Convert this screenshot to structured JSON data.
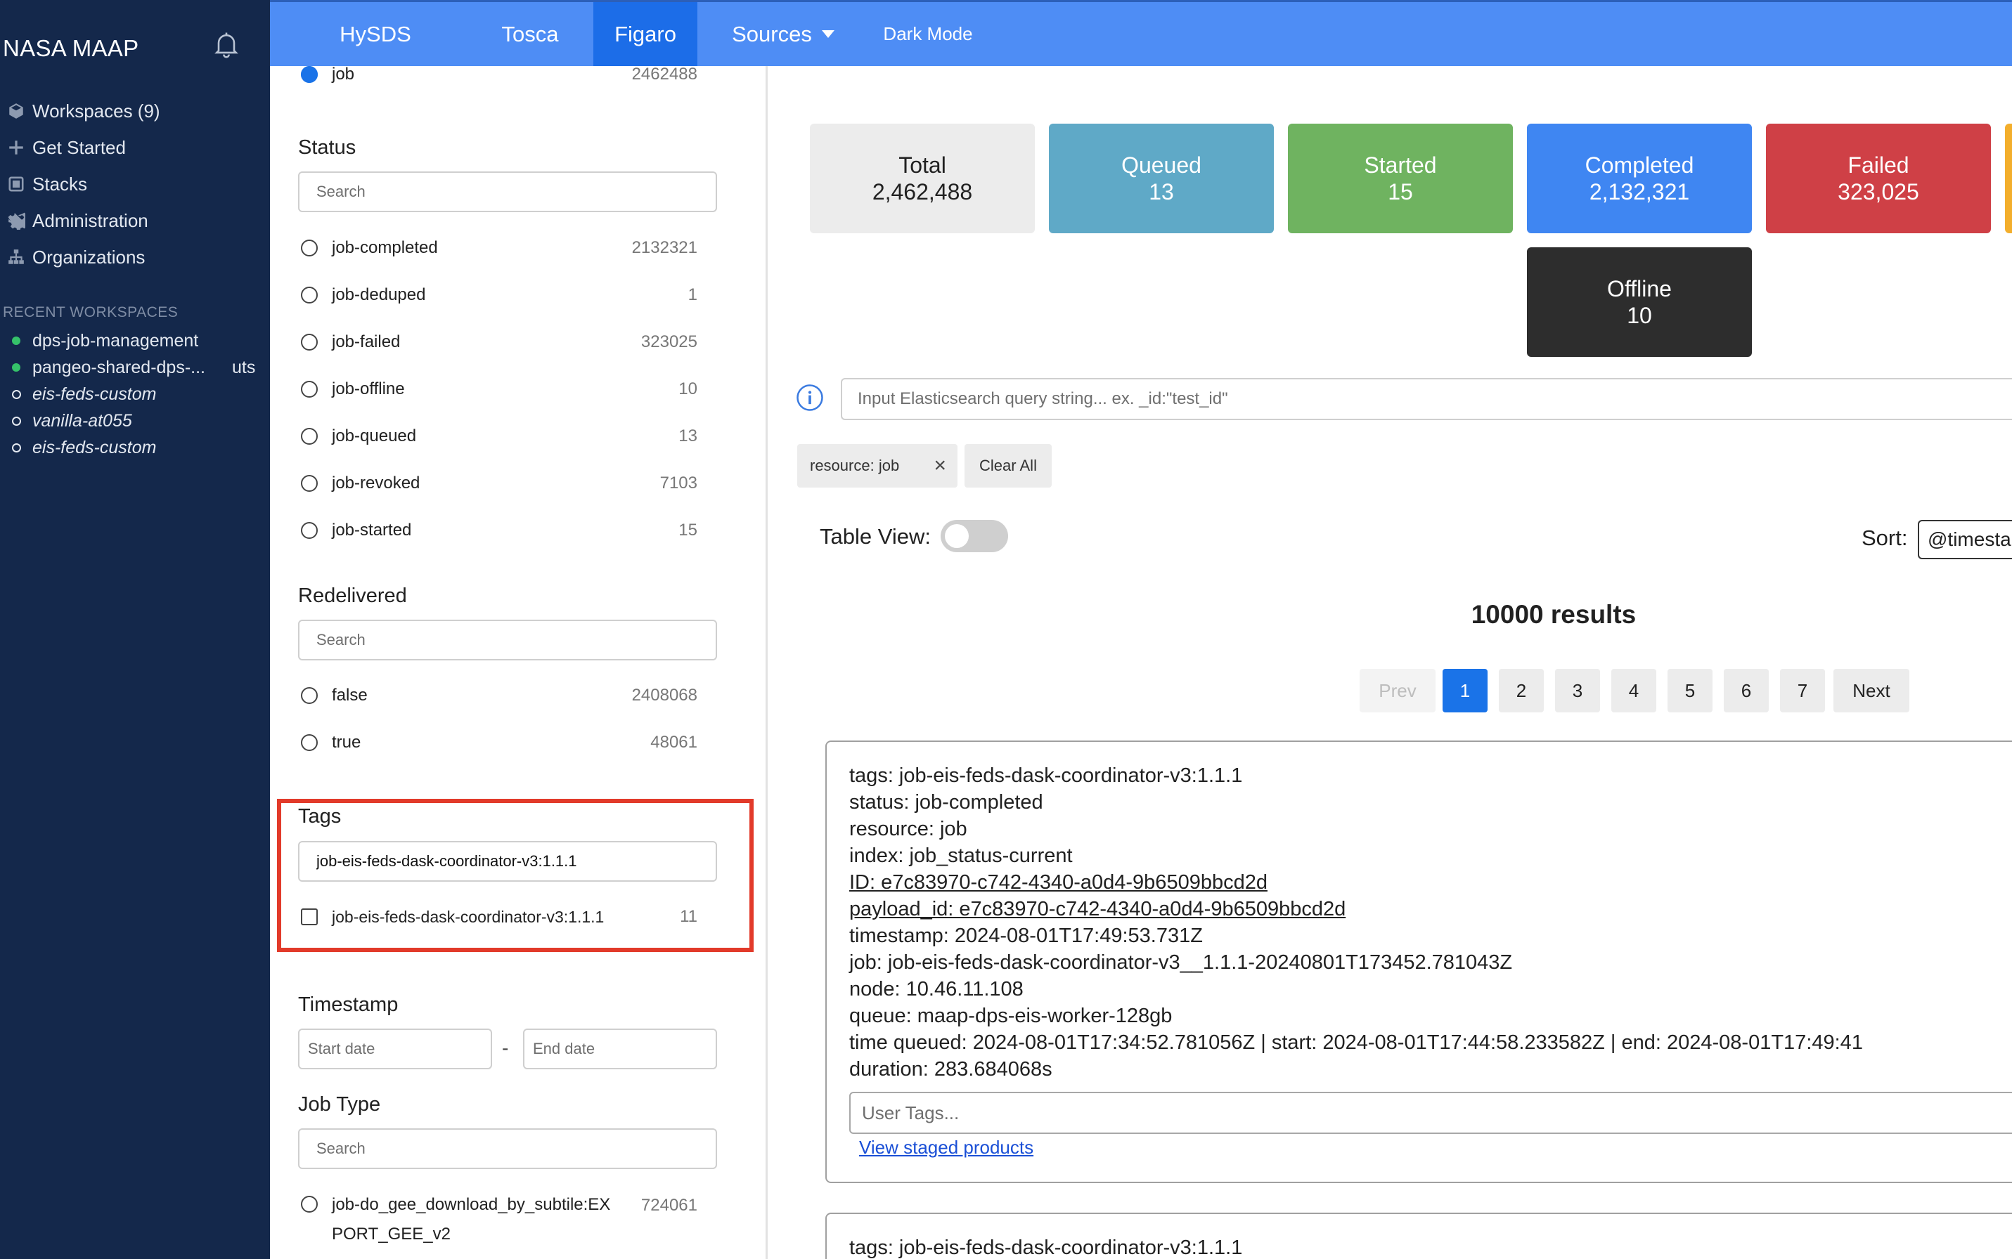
{
  "sidebar": {
    "brand": "NASA MAAP",
    "nav": [
      {
        "label": "Workspaces (9)",
        "icon": "cube-icon"
      },
      {
        "label": "Get Started",
        "icon": "plus-icon"
      },
      {
        "label": "Stacks",
        "icon": "stack-icon"
      },
      {
        "label": "Administration",
        "icon": "gear-icon"
      },
      {
        "label": "Organizations",
        "icon": "org-icon"
      }
    ],
    "recent_title": "RECENT WORKSPACES",
    "recent": [
      {
        "label": "dps-job-management",
        "status": "running"
      },
      {
        "label": "pangeo-shared-dps-...",
        "suffix": "uts",
        "status": "running"
      },
      {
        "label": "eis-feds-custom",
        "status": "stopped"
      },
      {
        "label": "vanilla-at055",
        "status": "stopped"
      },
      {
        "label": "eis-feds-custom",
        "status": "stopped"
      }
    ]
  },
  "topnav": {
    "tabs": [
      "HySDS",
      "Tosca",
      "Figaro",
      "Sources",
      "Dark Mode"
    ],
    "active_tab": "Figaro",
    "colors": {
      "bar": "#4e8df5",
      "active": "#1c6de8"
    }
  },
  "filters": {
    "resource_option": {
      "label": "job",
      "count": "2462488"
    },
    "status": {
      "heading": "Status",
      "search_placeholder": "Search",
      "options": [
        {
          "label": "job-completed",
          "count": "2132321"
        },
        {
          "label": "job-deduped",
          "count": "1"
        },
        {
          "label": "job-failed",
          "count": "323025"
        },
        {
          "label": "job-offline",
          "count": "10"
        },
        {
          "label": "job-queued",
          "count": "13"
        },
        {
          "label": "job-revoked",
          "count": "7103"
        },
        {
          "label": "job-started",
          "count": "15"
        }
      ]
    },
    "redelivered": {
      "heading": "Redelivered",
      "search_placeholder": "Search",
      "options": [
        {
          "label": "false",
          "count": "2408068"
        },
        {
          "label": "true",
          "count": "48061"
        }
      ]
    },
    "tags": {
      "heading": "Tags",
      "search_value": "job-eis-feds-dask-coordinator-v3:1.1.1",
      "options": [
        {
          "label": "job-eis-feds-dask-coordinator-v3:1.1.1",
          "count": "11"
        }
      ]
    },
    "timestamp": {
      "heading": "Timestamp",
      "start_placeholder": "Start date",
      "separator": "-",
      "end_placeholder": "End date"
    },
    "job_type": {
      "heading": "Job Type",
      "search_placeholder": "Search",
      "options": [
        {
          "label_line1": "job-do_gee_download_by_subtile:EX",
          "label_line2": "PORT_GEE_v2",
          "count": "724061"
        }
      ]
    }
  },
  "summary_cards": [
    {
      "label": "Total",
      "value": "2,462,488",
      "color": "#ececec"
    },
    {
      "label": "Queued",
      "value": "13",
      "color": "#5fa9c7"
    },
    {
      "label": "Started",
      "value": "15",
      "color": "#6fb360"
    },
    {
      "label": "Completed",
      "value": "2,132,321",
      "color": "#3f86f2"
    },
    {
      "label": "Failed",
      "value": "323,025",
      "color": "#cf4046"
    },
    {
      "label": "Offline",
      "value": "10",
      "color": "#2d2d2d"
    }
  ],
  "query": {
    "placeholder": "Input Elasticsearch query string... ex. _id:\"test_id\""
  },
  "active_filters": {
    "chip": "resource: job",
    "chip_remove": "×",
    "clear_all": "Clear All"
  },
  "view": {
    "table_view_label": "Table View:",
    "table_view_on": false,
    "sort_label": "Sort:",
    "sort_value": "@timestamp"
  },
  "results": {
    "count_text": "10000 results",
    "pager": {
      "prev": "Prev",
      "pages": [
        "1",
        "2",
        "3",
        "4",
        "5",
        "6",
        "7"
      ],
      "next": "Next",
      "current": "1"
    },
    "items": [
      {
        "tags": "tags: job-eis-feds-dask-coordinator-v3:1.1.1",
        "status": "status: job-completed",
        "resource": "resource: job",
        "index": "index: job_status-current",
        "id": "ID: e7c83970-c742-4340-a0d4-9b6509bbcd2d",
        "payload_id": "payload_id: e7c83970-c742-4340-a0d4-9b6509bbcd2d",
        "timestamp": "timestamp: 2024-08-01T17:49:53.731Z",
        "job": "job: job-eis-feds-dask-coordinator-v3__1.1.1-20240801T173452.781043Z",
        "node": "node: 10.46.11.108",
        "queue": "queue: maap-dps-eis-worker-128gb",
        "times": "time queued: 2024-08-01T17:34:52.781056Z | start: 2024-08-01T17:44:58.233582Z | end: 2024-08-01T17:49:41",
        "duration": "duration: 283.684068s",
        "user_tags_placeholder": "User Tags...",
        "staged_link": "View staged products"
      },
      {
        "tags": "tags: job-eis-feds-dask-coordinator-v3:1.1.1"
      }
    ]
  }
}
